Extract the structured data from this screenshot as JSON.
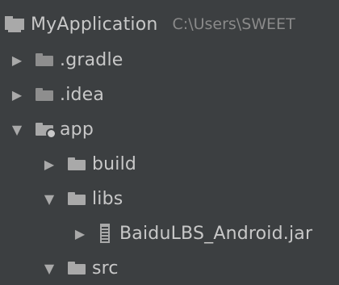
{
  "project": {
    "name": "MyApplication",
    "path": "C:\\Users\\SWEET"
  },
  "tree": {
    "gradle": ".gradle",
    "idea": ".idea",
    "app": "app",
    "build": "build",
    "libs": "libs",
    "jar": "BaiduLBS_Android.jar",
    "src": "src"
  },
  "icons": {
    "collapsed": "▶",
    "expanded": "▼"
  },
  "colors": {
    "background": "#3c3f41",
    "text": "#c8c8c8",
    "path_text": "#8a8a8a",
    "icon": "#a9a9a9"
  }
}
